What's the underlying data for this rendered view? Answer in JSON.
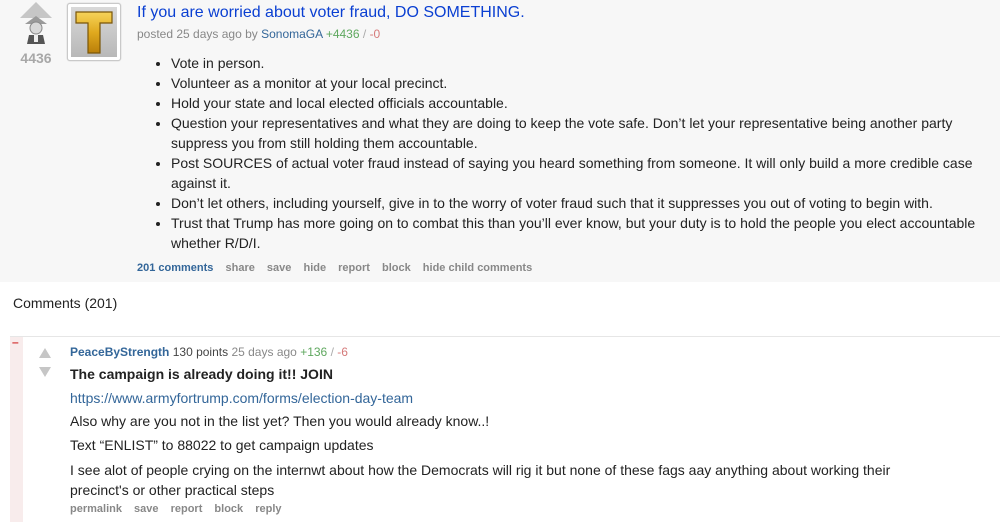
{
  "post": {
    "score": "4436",
    "title": "If you are worried about voter fraud, DO SOMETHING.",
    "tagline": {
      "prefix": "posted 25 days ago by",
      "author": "SonomaGA",
      "plus": "+4436",
      "sep": "/",
      "minus": "-0"
    },
    "thumbnail_letter": "T",
    "bullets": [
      "Vote in person.",
      "Volunteer as a monitor at your local precinct.",
      "Hold your state and local elected officials accountable.",
      "Question your representatives and what they are doing to keep the vote safe. Don’t let your representative being another party suppress you from still holding them accountable.",
      "Post SOURCES of actual voter fraud instead of saying you heard something from someone. It will only build a more credible case against it.",
      "Don’t let others, including yourself, give in to the worry of voter fraud such that it suppresses you out of voting to begin with.",
      "Trust that Trump has more going on to combat this than you’ll ever know, but your duty is to hold the people you elect accountable whether R/D/I."
    ],
    "links": {
      "comments": "201 comments",
      "share": "share",
      "save": "save",
      "hide": "hide",
      "report": "report",
      "block": "block",
      "hide_child": "hide child comments"
    }
  },
  "comments_heading": "Comments (201)",
  "comment": {
    "collapse": "–",
    "author": "PeaceByStrength",
    "points": "130 points",
    "age": "25 days ago",
    "plus": "+136",
    "sep": "/",
    "minus": "-6",
    "heading": "The campaign is already doing it!! JOIN",
    "link": "https://www.armyfortrump.com/forms/election-day-team",
    "para1": "Also why are you not in the list yet? Then you would already know..!",
    "para2": "Text “ENLIST” to 88022 to get campaign updates",
    "para3": "I see alot of people crying on the internwt about how the Democrats will rig it but none of these fags aay anything about working their precinct's or other practical steps",
    "links": {
      "permalink": "permalink",
      "save": "save",
      "report": "report",
      "block": "block",
      "reply": "reply"
    }
  },
  "colors": {
    "link_blue": "#336699",
    "title_blue": "#0a3fd2",
    "upvote_green": "#5fa85f",
    "downvote_red": "#d57a7a",
    "post_bg": "#f7f7f7"
  }
}
